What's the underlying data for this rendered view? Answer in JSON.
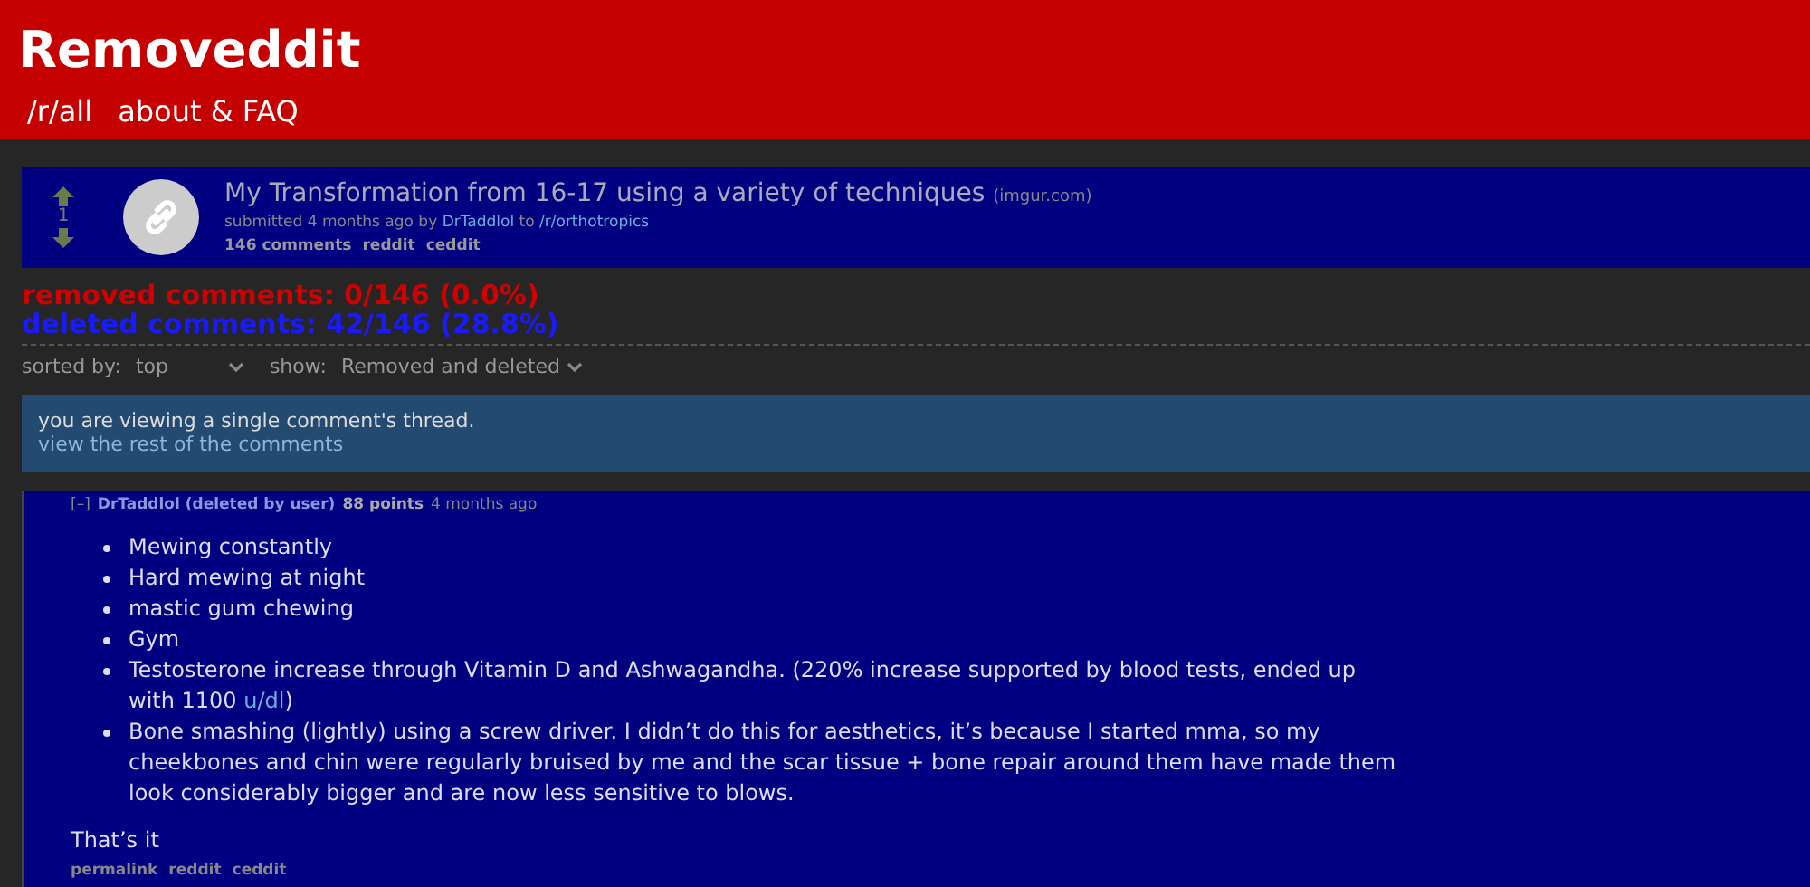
{
  "header": {
    "title": "Removeddit",
    "nav": [
      "/r/all",
      "about & FAQ"
    ]
  },
  "post": {
    "score": "1",
    "title": "My Transformation from 16-17 using a variety of techniques",
    "domain": "(imgur.com)",
    "submitted": "submitted 4 months ago by",
    "author": "DrTaddlol",
    "to": "to",
    "subreddit": "/r/orthotropics",
    "links": [
      "146 comments",
      "reddit",
      "ceddit"
    ]
  },
  "stats": {
    "removed": "removed comments: 0/146 (0.0%)",
    "deleted": "deleted comments: 42/146 (28.8%)"
  },
  "controls": {
    "sort_label": "sorted by:",
    "sort_value": "top",
    "show_label": "show:",
    "show_value": "Removed and deleted"
  },
  "notice": {
    "text": "you are viewing a single comment's thread.",
    "link": "view the rest of the comments"
  },
  "comment": {
    "toggle": "[–]",
    "author": "DrTaddlol (deleted by user)",
    "points": "88 points",
    "time": "4 months ago",
    "bullets": [
      [
        {
          "text": "Mewing constantly"
        }
      ],
      [
        {
          "text": "Hard mewing at night"
        }
      ],
      [
        {
          "text": "mastic gum chewing"
        }
      ],
      [
        {
          "text": "Gym"
        }
      ],
      [
        {
          "text": "Testosterone increase through Vitamin D and Ashwagandha. (220% increase supported by blood tests, ended up with 1100 "
        },
        {
          "link": "u/dl"
        },
        {
          "text": ")"
        }
      ],
      [
        {
          "text": "Bone smashing (lightly) using a screw driver. I didn’t do this for aesthetics, it’s because I started mma, so my cheekbones and chin were regularly bruised by me and the scar tissue + bone repair around them have made them look considerably bigger and are now less sensitive to blows."
        }
      ]
    ],
    "closing": "That’s it",
    "links": [
      "permalink",
      "reddit",
      "ceddit"
    ]
  }
}
